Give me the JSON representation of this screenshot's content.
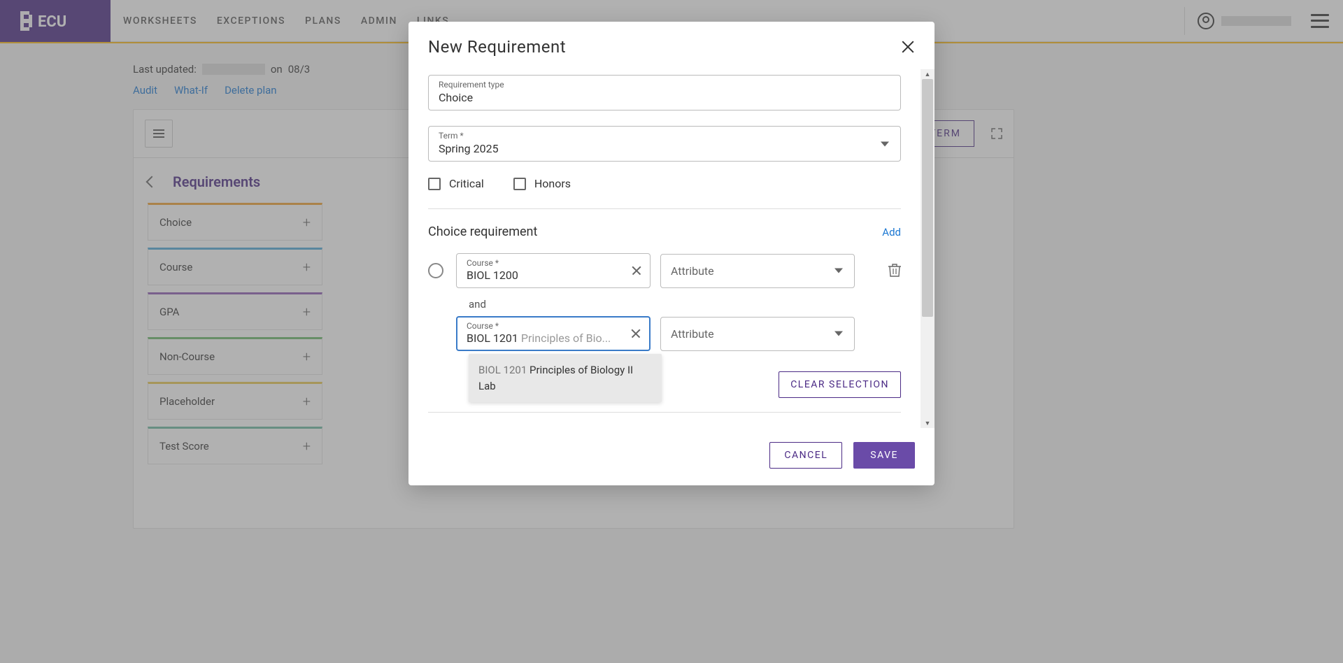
{
  "header": {
    "nav": [
      "WORKSHEETS",
      "EXCEPTIONS",
      "PLANS",
      "ADMIN",
      "LINKS"
    ]
  },
  "page": {
    "last_updated_label": "Last updated:",
    "on_label": "on",
    "date_partial": "08/3",
    "action_links": [
      "Audit",
      "What-If",
      "Delete plan"
    ],
    "add_term": "ADD TERM"
  },
  "requirements": {
    "chevron_name": "back",
    "title": "Requirements",
    "items": [
      {
        "label": "Choice"
      },
      {
        "label": "Course"
      },
      {
        "label": "GPA"
      },
      {
        "label": "Non-Course"
      },
      {
        "label": "Placeholder"
      },
      {
        "label": "Test Score"
      }
    ]
  },
  "modal": {
    "title": "New Requirement",
    "requirement_type_label": "Requirement type",
    "requirement_type_value": "Choice",
    "term_label": "Term *",
    "term_value": "Spring 2025",
    "critical_label": "Critical",
    "honors_label": "Honors",
    "section_title": "Choice requirement",
    "add_label": "Add",
    "course_label": "Course *",
    "attribute_label": "Attribute",
    "and_label": "and",
    "row1": {
      "course_value": "BIOL 1200"
    },
    "row2": {
      "course_value": "BIOL 1201",
      "course_hint": "Principles of Bio..."
    },
    "autocomplete": {
      "code": "BIOL 1201",
      "desc": "Principles of Biology II Lab"
    },
    "clear_selection": "CLEAR SELECTION",
    "cancel": "CANCEL",
    "save": "SAVE"
  }
}
